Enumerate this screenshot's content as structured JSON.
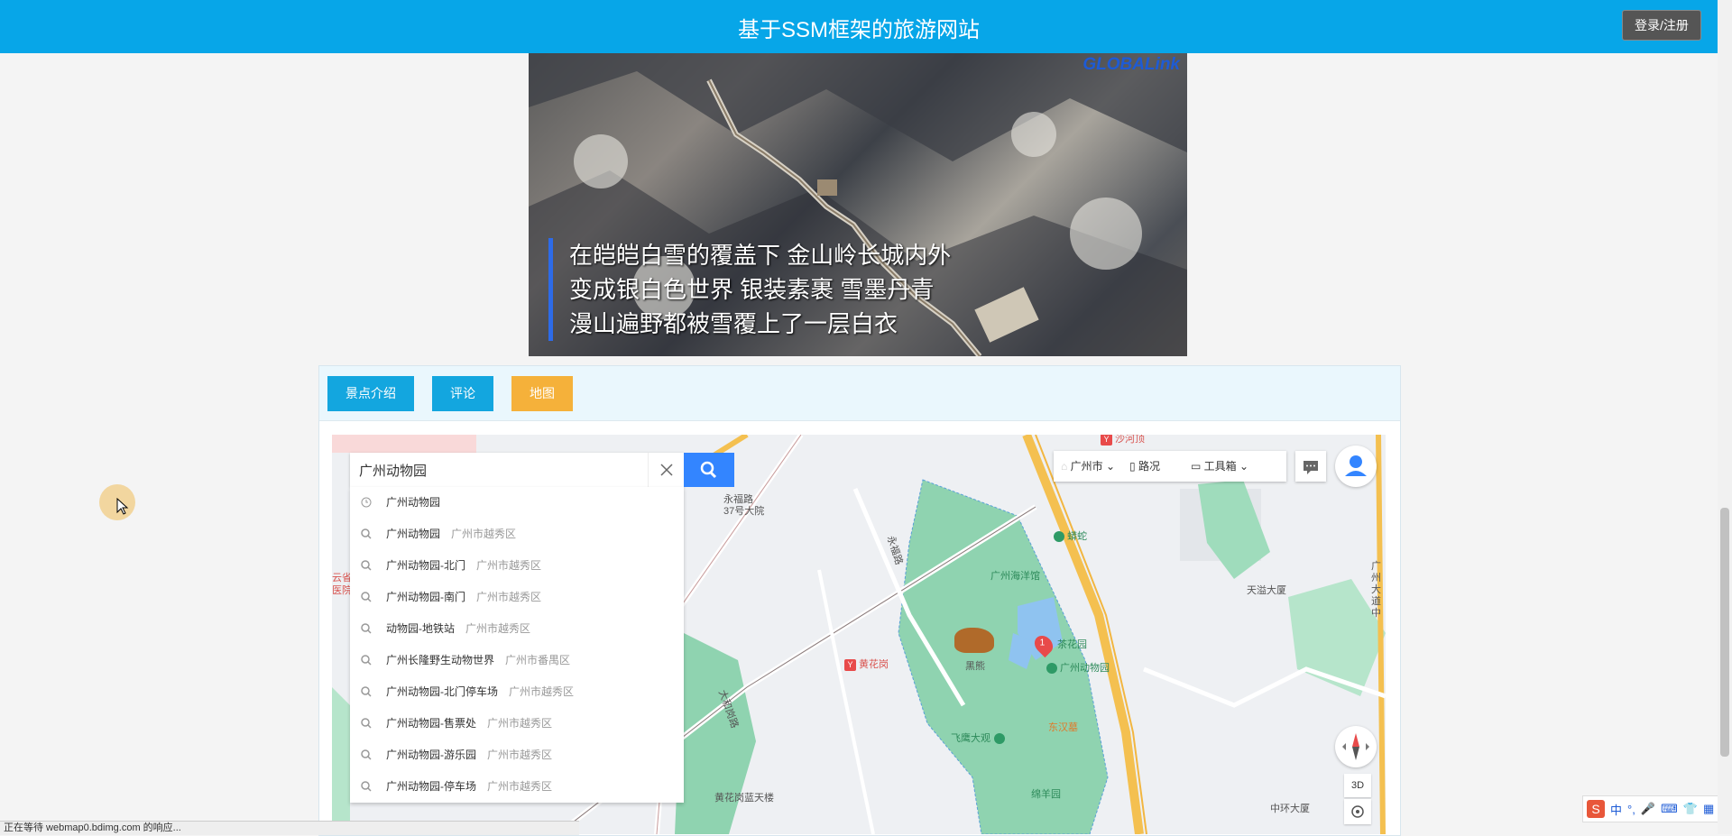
{
  "header": {
    "title": "基于SSM框架的旅游网站",
    "login_label": "登录/注册"
  },
  "video": {
    "logo": "GLOBALink",
    "captions": [
      "在皑皑白雪的覆盖下 金山岭长城内外",
      "变成银白色世界 银装素裹 雪墨丹青",
      "漫山遍野都被雪覆上了一层白衣"
    ]
  },
  "tabs": [
    {
      "label": "景点介绍"
    },
    {
      "label": "评论"
    },
    {
      "label": "地图",
      "active": true
    }
  ],
  "map": {
    "search": {
      "value": "广州动物园"
    },
    "suggestions": [
      {
        "name": "广州动物园",
        "district": "",
        "icon": "history-icon"
      },
      {
        "name": "广州动物园",
        "district": "广州市越秀区",
        "icon": "search-icon"
      },
      {
        "name": "广州动物园-北门",
        "district": "广州市越秀区",
        "icon": "search-icon"
      },
      {
        "name": "广州动物园-南门",
        "district": "广州市越秀区",
        "icon": "search-icon"
      },
      {
        "name": "动物园-地铁站",
        "district": "广州市越秀区",
        "icon": "search-icon"
      },
      {
        "name": "广州长隆野生动物世界",
        "district": "广州市番禺区",
        "icon": "search-icon"
      },
      {
        "name": "广州动物园-北门停车场",
        "district": "广州市越秀区",
        "icon": "search-icon"
      },
      {
        "name": "广州动物园-售票处",
        "district": "广州市越秀区",
        "icon": "search-icon"
      },
      {
        "name": "广州动物园-游乐园",
        "district": "广州市越秀区",
        "icon": "search-icon"
      },
      {
        "name": "广州动物园-停车场",
        "district": "广州市越秀区",
        "icon": "search-icon"
      }
    ],
    "toolbar": {
      "city": "广州市",
      "traffic": "路况",
      "toolbox": "工具箱"
    },
    "btn_3d": "3D",
    "labels": {
      "shahe": "沙河顶",
      "yongfu": "永福路\n37号大院",
      "yongfu_road": "永福路",
      "ocean": "广州海洋馆",
      "python": "蟒蛇",
      "teahouse": "茶花园",
      "zoo": "广州动物园",
      "bear": "黑熊",
      "huanghuagang": "黄花岗",
      "eagle": "飞鹰大观",
      "hanwu": "东汉墓",
      "tianji": "天溢大厦",
      "sheep": "绵羊园",
      "huangtower": "黄花岗蓝天楼",
      "zhonghuan": "中环大厦",
      "dahe": "大和岗路",
      "hospital": "云省\n医院",
      "guangzhou_road": "广州大道中",
      "zoo_marker": "1"
    }
  },
  "ime": {
    "label": "中"
  },
  "status_bar": "正在等待 webmap0.bdimg.com 的响应..."
}
